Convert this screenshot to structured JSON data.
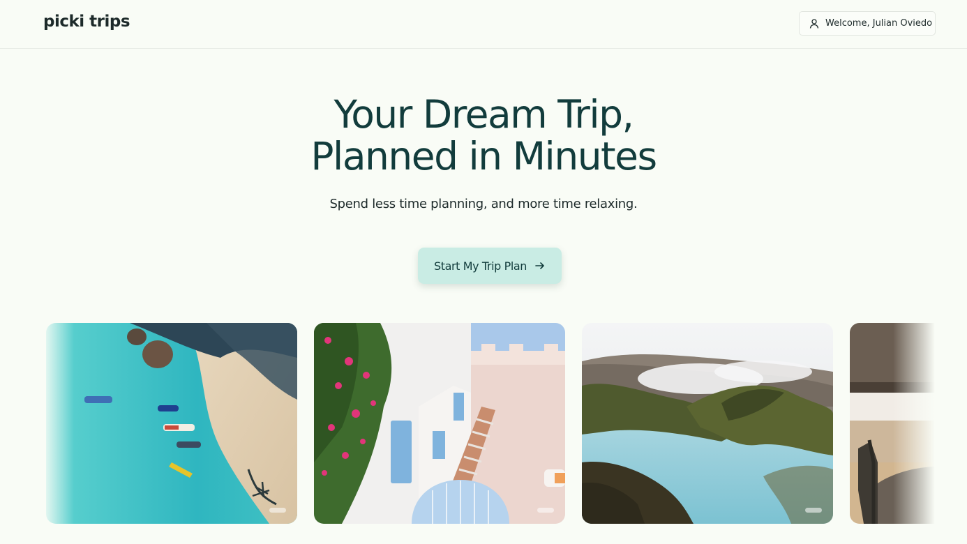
{
  "header": {
    "logo_text": "picki trips",
    "welcome_label": "Welcome, Julian Oviedo",
    "user_icon": "user-icon"
  },
  "hero": {
    "title_line1": "Your Dream Trip,",
    "title_line2": "Planned in Minutes",
    "subtitle": "Spend less time planning, and more time relaxing.",
    "cta_label": "Start My Trip Plan",
    "cta_icon": "arrow-right-icon"
  },
  "gallery": {
    "items": [
      {
        "subject": "beach-boats-photo"
      },
      {
        "subject": "santorini-stairs-photo"
      },
      {
        "subject": "blue-lagoon-photo"
      },
      {
        "subject": "safari-jeep-photo"
      }
    ]
  },
  "colors": {
    "background": "#f9fcf6",
    "title": "#123c3c",
    "cta_background": "#c9ece4",
    "text": "#1d2a2a"
  }
}
